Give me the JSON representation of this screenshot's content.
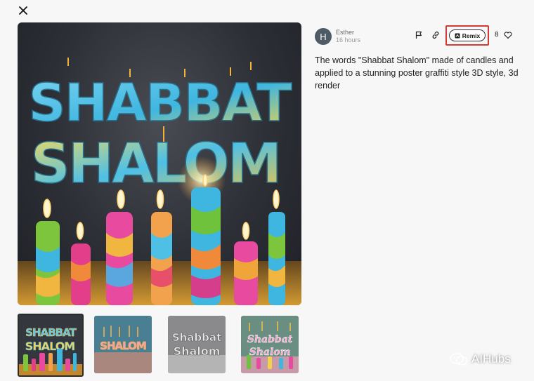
{
  "modal": {
    "close_icon": "close-icon"
  },
  "artwork": {
    "headline_line1": "SHABBAT",
    "headline_line2": "SHALOM"
  },
  "thumbnails": [
    {
      "label_top": "SHABBAT",
      "label_bottom": "SHALOM"
    },
    {
      "label_top": "",
      "label_bottom": "SHALOM"
    },
    {
      "label_top": "Shabbat",
      "label_bottom": "Shalom"
    },
    {
      "label_top": "Shabbat",
      "label_bottom": "Shalom"
    }
  ],
  "author": {
    "initial": "H",
    "name": "Esther",
    "time": "16 hours"
  },
  "actions": {
    "remix_label": "Remix",
    "like_count": "8",
    "highlight_color": "#d23a3a"
  },
  "prompt_text": "The words \"Shabbat Shalom\" made of candles and applied to a stunning poster graffiti style 3D style, 3d render",
  "watermark": {
    "text": "AIHubs"
  },
  "colors": {
    "background": "#f7f7f8",
    "accent_blue": "#3fb6e0",
    "accent_yellow": "#f3d24a",
    "accent_pink": "#e33e8a",
    "accent_green": "#6fc23c"
  }
}
